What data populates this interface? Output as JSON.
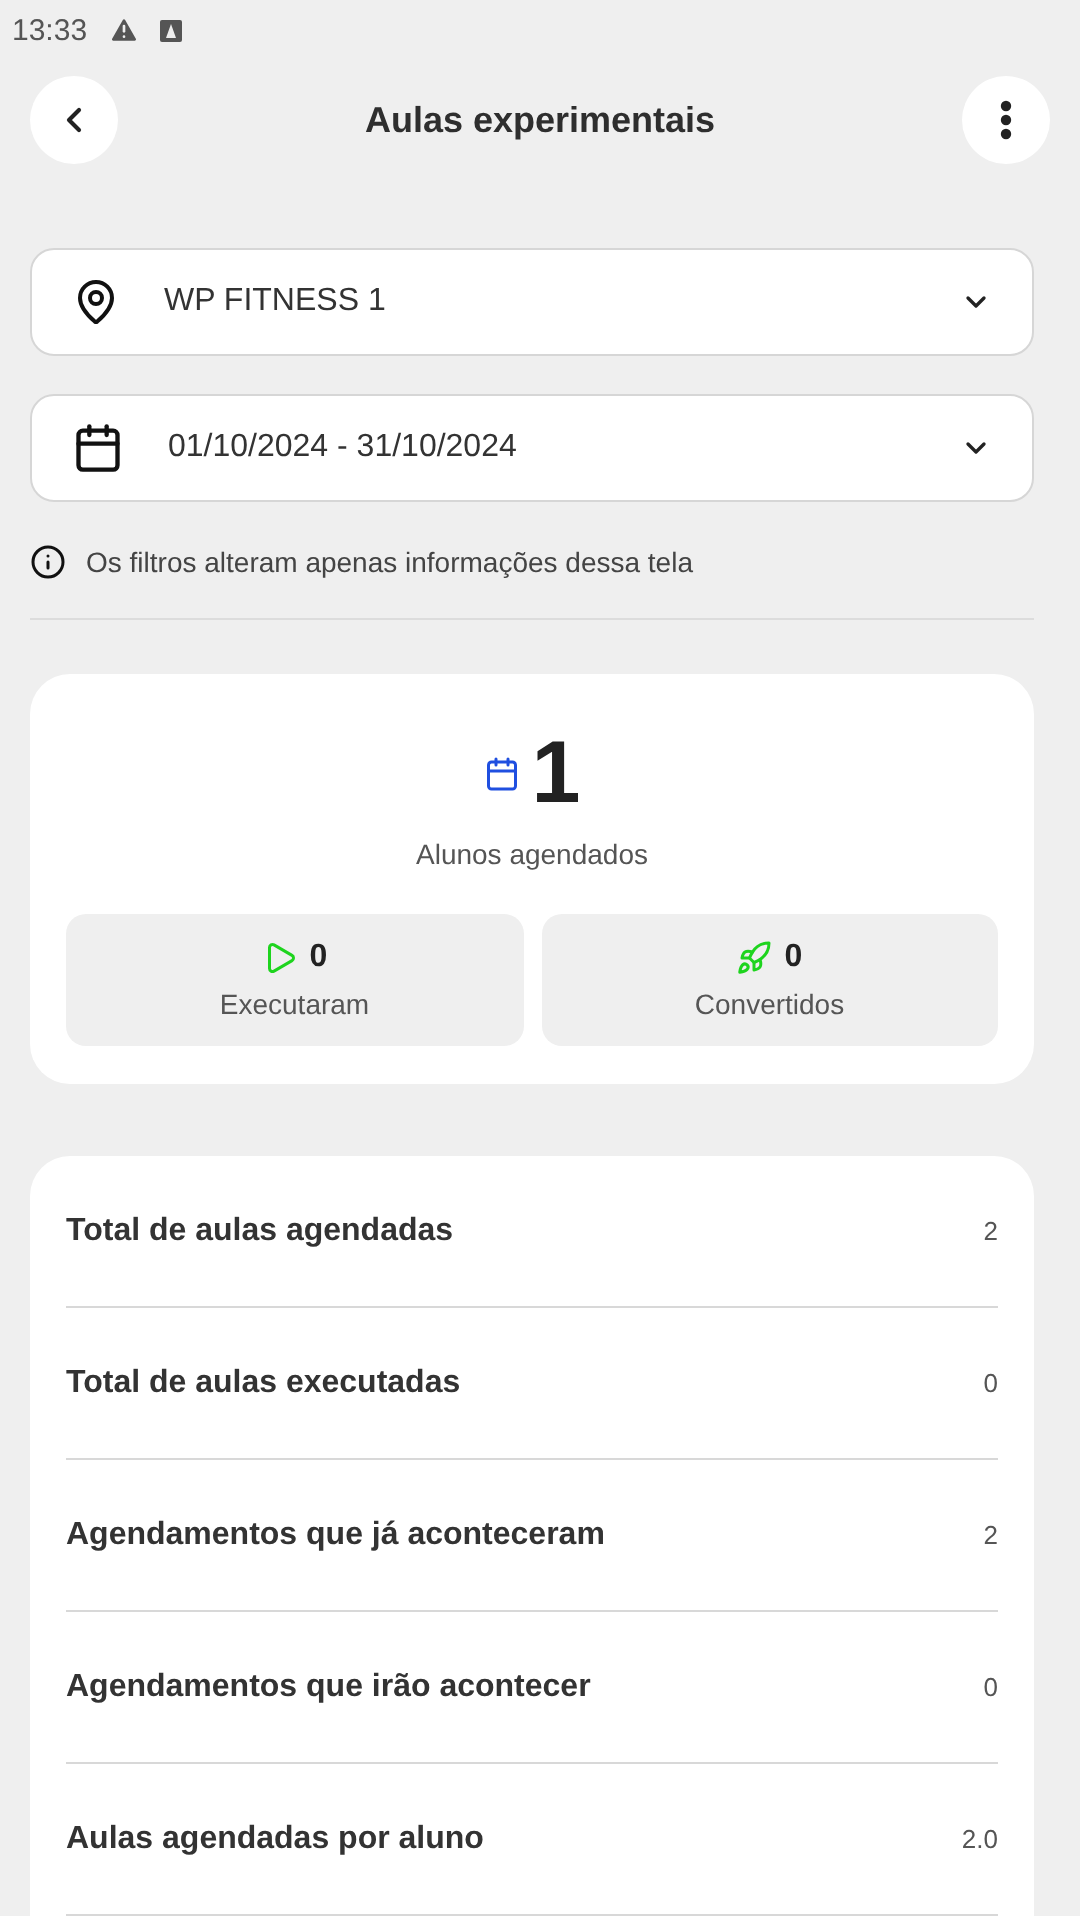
{
  "status_bar": {
    "time": "13:33"
  },
  "header": {
    "title": "Aulas experimentais"
  },
  "filters": [
    {
      "kind": "location",
      "value": "WP FITNESS 1"
    },
    {
      "kind": "date",
      "value": "01/10/2024 - 31/10/2024"
    }
  ],
  "filter_note": "Os filtros alteram apenas informações dessa tela",
  "summary": {
    "value": "1",
    "label": "Alunos agendados",
    "stats": [
      {
        "kind": "executed",
        "value": "0",
        "label": "Executaram",
        "color": "#1ed41e"
      },
      {
        "kind": "converted",
        "value": "0",
        "label": "Convertidos",
        "color": "#1ed41e"
      }
    ]
  },
  "metrics": [
    {
      "label": "Total de aulas agendadas",
      "value": "2"
    },
    {
      "label": "Total de aulas executadas",
      "value": "0"
    },
    {
      "label": "Agendamentos que já aconteceram",
      "value": "2"
    },
    {
      "label": "Agendamentos que irão acontecer",
      "value": "0"
    },
    {
      "label": "Aulas agendadas por aluno",
      "value": "2.0"
    }
  ]
}
